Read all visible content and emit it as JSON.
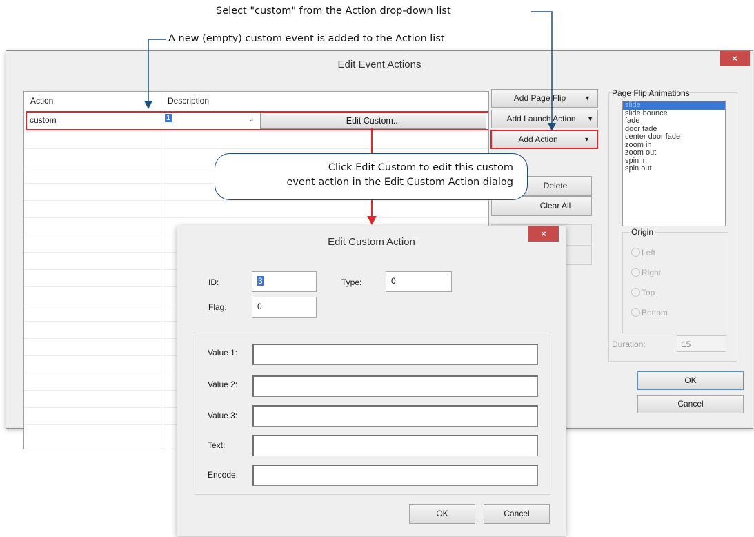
{
  "annotations": {
    "select_custom": "Select \"custom\" from the Action drop-down list",
    "new_event": "A new (empty) custom event is added to the Action list",
    "click_edit_line1": "Click Edit Custom to edit this custom",
    "click_edit_line2": "event action in the Edit Custom Action dialog"
  },
  "main_window": {
    "title": "Edit Event Actions",
    "close_glyph": "×",
    "grid": {
      "columns": [
        "Action",
        "Description"
      ],
      "rows": [
        {
          "action": "custom",
          "description": "1",
          "button": "Edit Custom..."
        }
      ]
    },
    "buttons": {
      "add_page_flip": "Add Page Flip",
      "add_launch_action": "Add Launch Action",
      "add_action": "Add Action",
      "delete": "Delete",
      "clear_all": "Clear All",
      "ok": "OK",
      "cancel": "Cancel"
    },
    "page_flip": {
      "label": "Page Flip Animations",
      "items": [
        "slide",
        "slide bounce",
        "fade",
        "door fade",
        "center door fade",
        "zoom in",
        "zoom out",
        "spin in",
        "spin out"
      ],
      "selected": "slide",
      "origin": {
        "label": "Origin",
        "options": [
          "Left",
          "Right",
          "Top",
          "Bottom"
        ]
      },
      "duration_label": "Duration:",
      "duration_value": "15"
    }
  },
  "dialog": {
    "title": "Edit Custom Action",
    "close_glyph": "×",
    "id_label": "ID:",
    "id_value": "3",
    "type_label": "Type:",
    "type_value": "0",
    "flag_label": "Flag:",
    "flag_value": "0",
    "fields": [
      "Value 1:",
      "Value 2:",
      "Value 3:",
      "Text:",
      "Encode:"
    ],
    "ok": "OK",
    "cancel": "Cancel"
  },
  "colors": {
    "highlight_red": "#e3262b",
    "annotation_blue": "#1f4e7a",
    "selection_blue": "#3a78d8"
  }
}
